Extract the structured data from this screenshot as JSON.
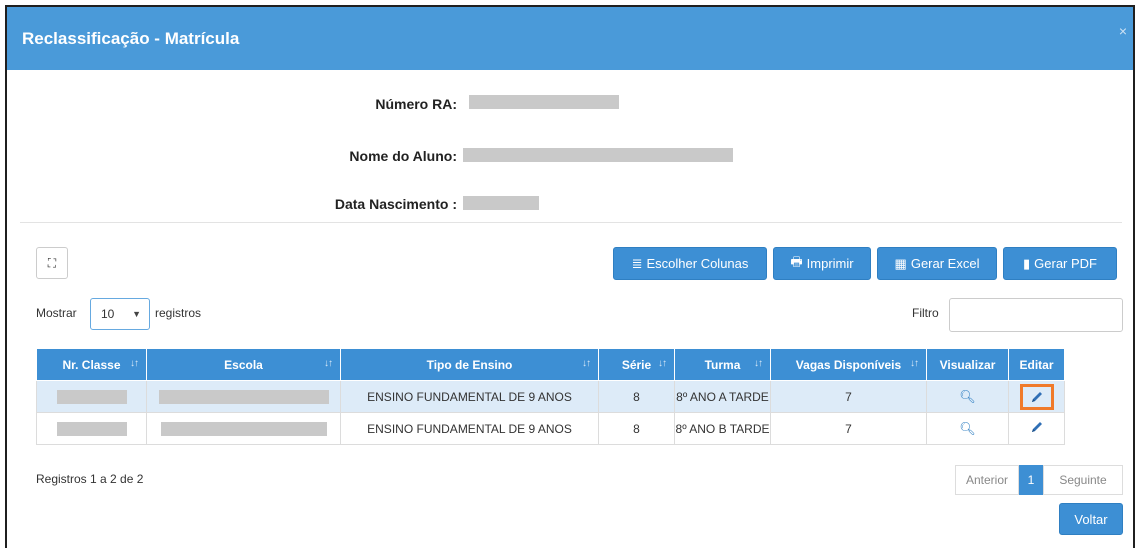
{
  "modal": {
    "title": "Reclassificação - Matrícula",
    "close": "×"
  },
  "student": {
    "ra_label": "Número RA:",
    "name_label": "Nome do Aluno:",
    "birth_label": "Data Nascimento :"
  },
  "toolbar": {
    "expand_icon": "⛶",
    "choose_columns": "Escolher Colunas",
    "print": "Imprimir",
    "excel": "Gerar Excel",
    "pdf": "Gerar PDF"
  },
  "list_controls": {
    "show_label": "Mostrar",
    "page_size": "10",
    "records_label": "registros",
    "filter_label": "Filtro",
    "filter_value": ""
  },
  "table": {
    "headers": [
      "Nr. Classe",
      "Escola",
      "Tipo de Ensino",
      "Série",
      "Turma",
      "Vagas Disponíveis",
      "Visualizar",
      "Editar"
    ],
    "rows": [
      {
        "tipo": "ENSINO FUNDAMENTAL DE 9 ANOS",
        "serie": "8",
        "turma": "8º ANO A TARDE",
        "vagas": "7"
      },
      {
        "tipo": "ENSINO FUNDAMENTAL DE 9 ANOS",
        "serie": "8",
        "turma": "8º ANO B TARDE",
        "vagas": "7"
      }
    ]
  },
  "footer": {
    "records_info": "Registros 1 a 2 de 2",
    "prev": "Anterior",
    "page": "1",
    "next": "Seguinte",
    "back": "Voltar"
  },
  "colors": {
    "header_blue": "#4a9ad9",
    "button_blue": "#3d8fd4",
    "highlight_orange": "#f07a2a"
  }
}
